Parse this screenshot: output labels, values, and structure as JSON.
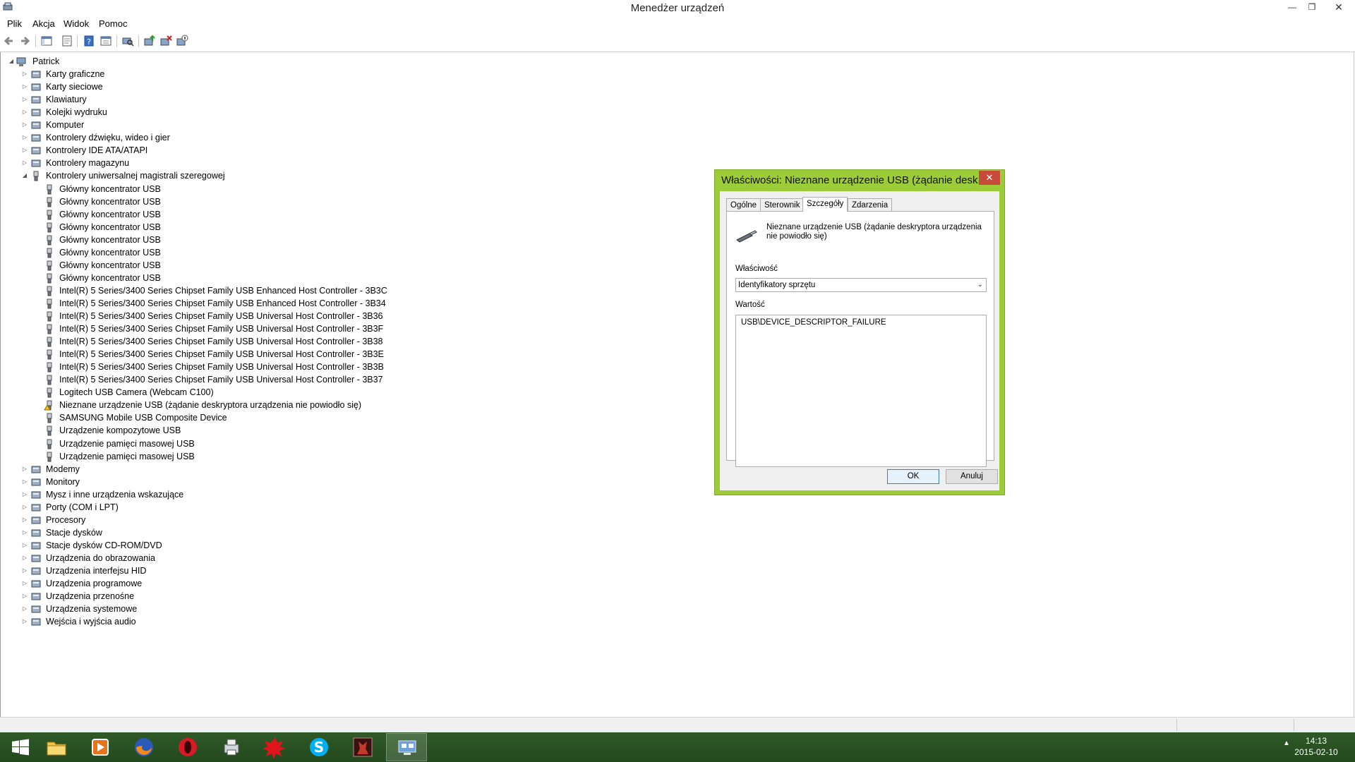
{
  "window": {
    "title": "Menedżer urządzeń"
  },
  "menu": [
    "Plik",
    "Akcja",
    "Widok",
    "Pomoc"
  ],
  "tree": {
    "root": "Patrick",
    "categories_before": [
      "Karty graficzne",
      "Karty sieciowe",
      "Klawiatury",
      "Kolejki wydruku",
      "Komputer",
      "Kontrolery dźwięku, wideo i gier",
      "Kontrolery IDE ATA/ATAPI",
      "Kontrolery magazynu"
    ],
    "expanded_category": "Kontrolery uniwersalnej magistrali szeregowej",
    "usb_devices": [
      "Główny koncentrator USB",
      "Główny koncentrator USB",
      "Główny koncentrator USB",
      "Główny koncentrator USB",
      "Główny koncentrator USB",
      "Główny koncentrator USB",
      "Główny koncentrator USB",
      "Główny koncentrator USB",
      "Intel(R) 5 Series/3400 Series Chipset Family USB Enhanced Host Controller - 3B3C",
      "Intel(R) 5 Series/3400 Series Chipset Family USB Enhanced Host Controller - 3B34",
      "Intel(R) 5 Series/3400 Series Chipset Family USB Universal Host Controller - 3B36",
      "Intel(R) 5 Series/3400 Series Chipset Family USB Universal Host Controller - 3B3F",
      "Intel(R) 5 Series/3400 Series Chipset Family USB Universal Host Controller - 3B38",
      "Intel(R) 5 Series/3400 Series Chipset Family USB Universal Host Controller - 3B3E",
      "Intel(R) 5 Series/3400 Series Chipset Family USB Universal Host Controller - 3B3B",
      "Intel(R) 5 Series/3400 Series Chipset Family USB Universal Host Controller - 3B37",
      "Logitech USB Camera (Webcam C100)",
      "Nieznane urządzenie USB (żądanie deskryptora urządzenia nie powiodło się)",
      "SAMSUNG Mobile USB Composite Device",
      "Urządzenie kompozytowe USB",
      "Urządzenie pamięci masowej USB",
      "Urządzenie pamięci masowej USB"
    ],
    "warning_device_index": 17,
    "categories_after": [
      "Modemy",
      "Monitory",
      "Mysz i inne urządzenia wskazujące",
      "Porty (COM i LPT)",
      "Procesory",
      "Stacje dysków",
      "Stacje dysków CD-ROM/DVD",
      "Urządzenia do obrazowania",
      "Urządzenia interfejsu HID",
      "Urządzenia programowe",
      "Urządzenia przenośne",
      "Urządzenia systemowe",
      "Wejścia i wyjścia audio"
    ]
  },
  "dialog": {
    "title": "Właściwości: Nieznane urządzenie USB (żądanie desk...",
    "tabs": [
      "Ogólne",
      "Sterownik",
      "Szczegóły",
      "Zdarzenia"
    ],
    "active_tab": "Szczegóły",
    "device_name": "Nieznane urządzenie USB (żądanie deskryptora urządzenia nie powiodło się)",
    "property_label": "Właściwość",
    "property_value": "Identyfikatory sprzętu",
    "value_label": "Wartość",
    "value": "USB\\DEVICE_DESCRIPTOR_FAILURE",
    "ok_label": "OK",
    "cancel_label": "Anuluj"
  },
  "taskbar": {
    "apps": [
      "start",
      "file-explorer",
      "media-player",
      "firefox",
      "opera",
      "device-manager-taskbar",
      "game-app",
      "skype",
      "game-app-2",
      "device-manager-active"
    ],
    "time": "14:13",
    "date": "2015-02-10"
  }
}
